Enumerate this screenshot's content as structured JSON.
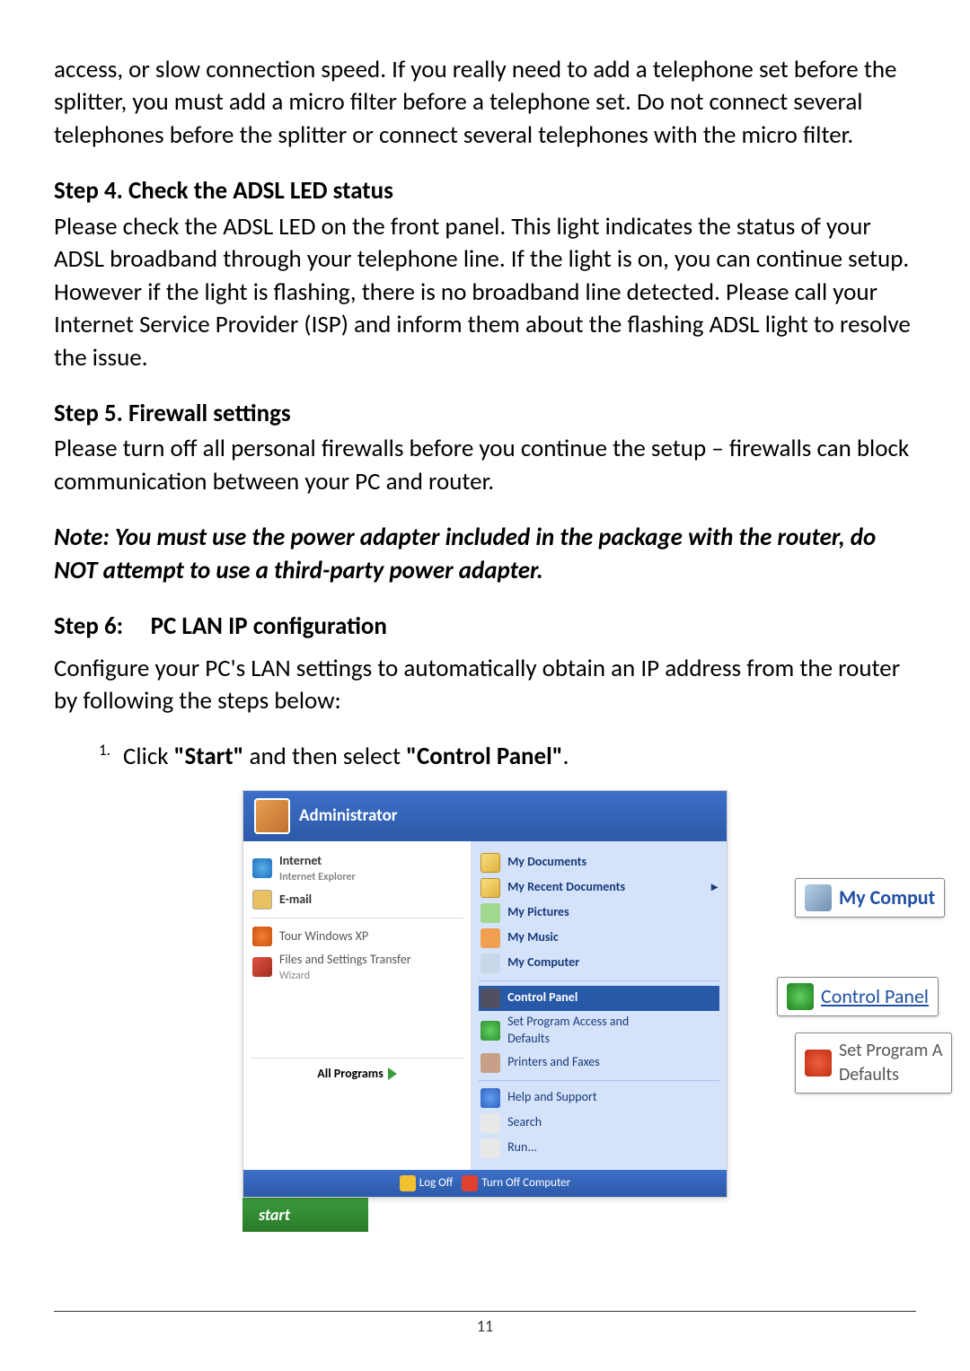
{
  "para1": "access, or slow connection speed. If you really need to add a telephone set before the splitter, you must add a micro filter before a telephone set. Do not connect several telephones before the splitter or connect several telephones with the micro filter.",
  "step4": {
    "heading": "Step 4. Check the ADSL LED status",
    "body": "Please check the ADSL LED on the front panel. This light indicates the status of your ADSL broadband through your telephone line. If the light is on, you can continue setup. However if the light is flashing, there is no broadband line detected. Please call your Internet Service Provider (ISP) and inform them about the flashing ADSL light to resolve the issue."
  },
  "step5": {
    "heading": "Step 5. Firewall settings",
    "body": "Please turn off all personal firewalls before you continue the setup – firewalls can block communication between your PC and router."
  },
  "note": "Note: You must use the power adapter included in the package with the router, do NOT attempt to use a third-party power adapter.",
  "step6": {
    "heading": "Step 6:     PC LAN IP configuration",
    "body": "Configure your PC's LAN settings to automatically obtain an IP address from the router by following the steps below:"
  },
  "list": {
    "num": "1.",
    "pre": "Click ",
    "bold1": "\"Start\"",
    "mid": " and then select ",
    "bold2": "\"Control Panel\"",
    "end": "."
  },
  "menu": {
    "user": "Administrator",
    "left": {
      "internet": "Internet",
      "internet_sub": "Internet Explorer",
      "email": "E-mail",
      "tour": "Tour Windows XP",
      "transfer": "Files and Settings Transfer",
      "transfer_sub": "Wizard",
      "all_programs": "All Programs"
    },
    "right": {
      "docs": "My Documents",
      "recent": "My Recent Documents",
      "pics": "My Pictures",
      "music": "My Music",
      "computer": "My Computer",
      "panel": "Control Panel",
      "access": "Set Program Access and",
      "access2": "Defaults",
      "printers": "Printers and Faxes",
      "help": "Help and Support",
      "search": "Search",
      "run": "Run..."
    },
    "footer": {
      "logoff": "Log Off",
      "turnoff": "Turn Off Computer"
    },
    "start": "start"
  },
  "callouts": {
    "computer": "My Comput",
    "panel": "Control Panel",
    "access1": "Set Program A",
    "access2": "Defaults"
  },
  "page_num": "11"
}
